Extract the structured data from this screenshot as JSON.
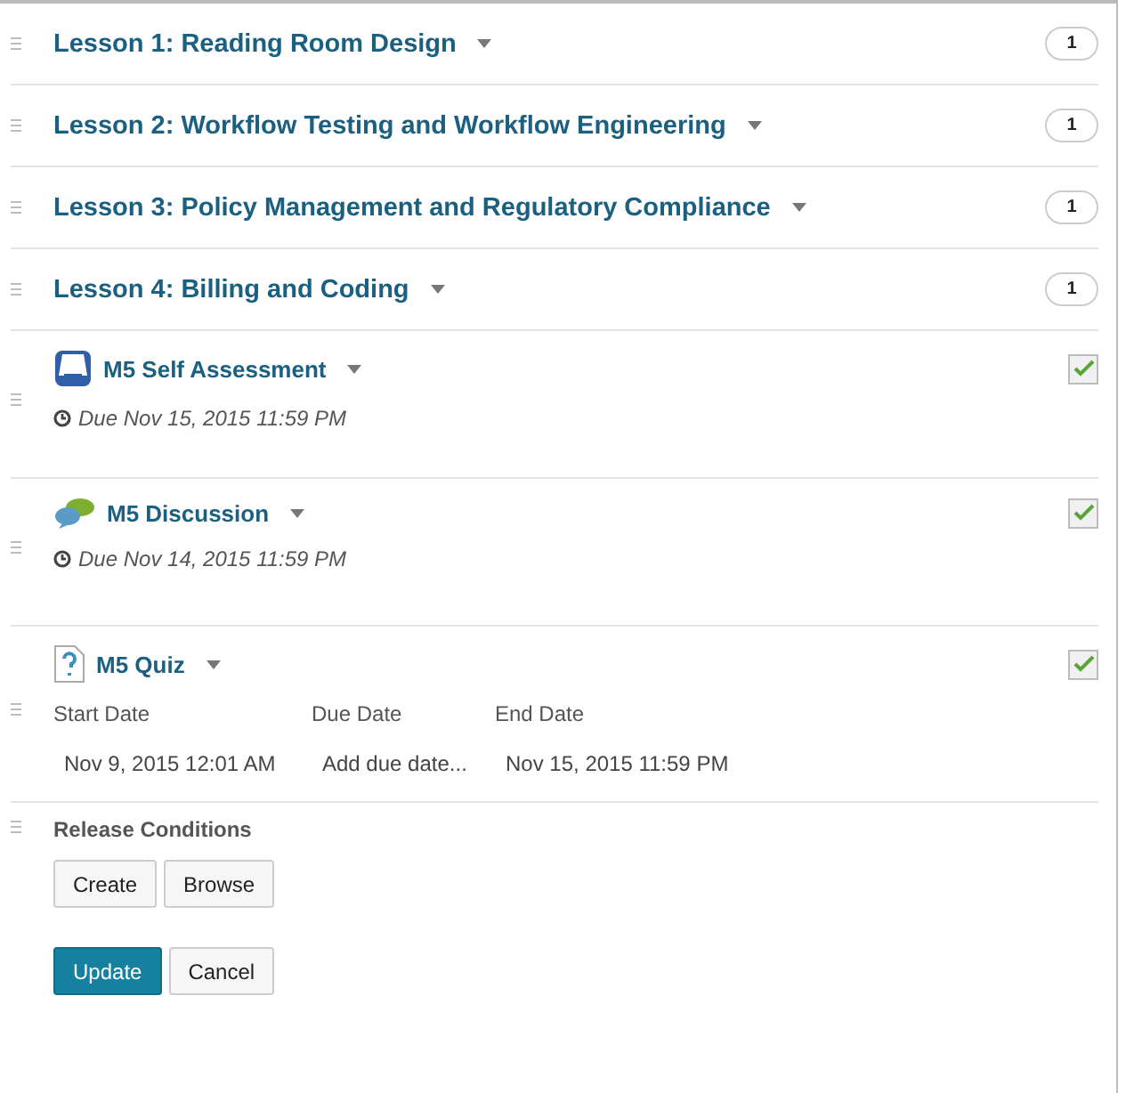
{
  "lessons": [
    {
      "title": "Lesson 1: Reading Room Design",
      "count": "1"
    },
    {
      "title": "Lesson 2: Workflow Testing and Workflow Engineering",
      "count": "1"
    },
    {
      "title": "Lesson 3: Policy Management and Regulatory Compliance",
      "count": "1"
    },
    {
      "title": "Lesson 4: Billing and Coding",
      "count": "1"
    }
  ],
  "items": [
    {
      "kind": "assessment",
      "title": "M5 Self Assessment",
      "due": "Due Nov 15, 2015 11:59 PM",
      "checked": true
    },
    {
      "kind": "discussion",
      "title": "M5 Discussion",
      "due": "Due Nov 14, 2015 11:59 PM",
      "checked": true
    },
    {
      "kind": "quiz",
      "title": "M5 Quiz",
      "checked": true,
      "dates": {
        "headers": [
          "Start Date",
          "Due Date",
          "End Date"
        ],
        "values": [
          "Nov 9, 2015 12:01 AM",
          "Add due date...",
          "Nov 15, 2015 11:59 PM"
        ]
      }
    }
  ],
  "release": {
    "label": "Release Conditions",
    "buttons": [
      "Create",
      "Browse"
    ]
  },
  "actions": [
    {
      "label": "Update",
      "primary": true
    },
    {
      "label": "Cancel",
      "primary": false
    }
  ]
}
